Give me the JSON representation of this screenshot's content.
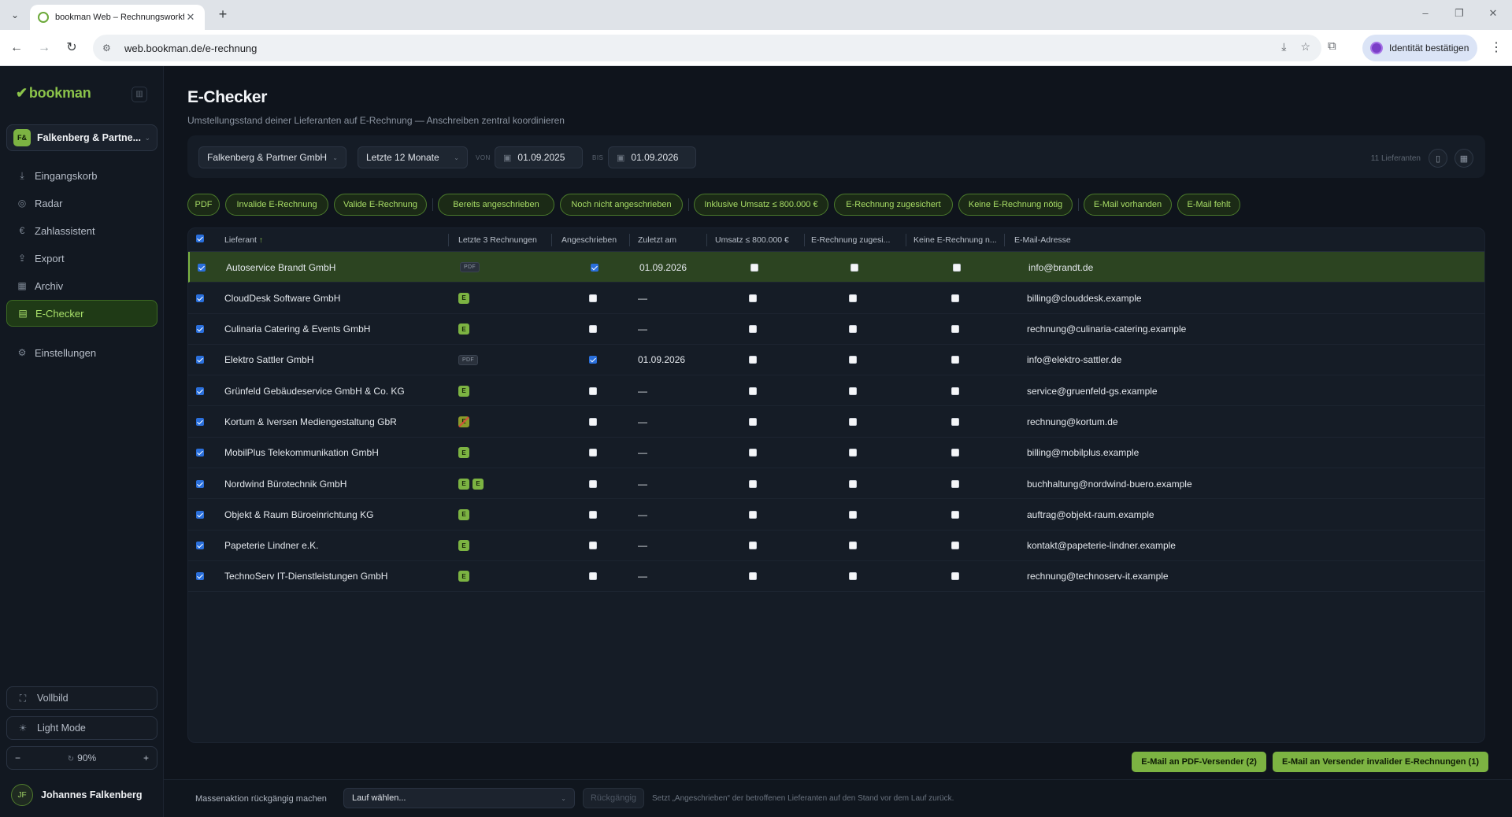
{
  "browser": {
    "tab_title": "bookman Web – Rechnungsworkfl",
    "url": "web.bookman.de/e-rechnung",
    "identity_label": "Identität bestätigen"
  },
  "sidebar": {
    "logo": "bookman",
    "company_badge": "F&",
    "company_name": "Falkenberg & Partne...",
    "nav": [
      {
        "label": "Eingangskorb",
        "icon": "inbox-icon"
      },
      {
        "label": "Radar",
        "icon": "radar-icon"
      },
      {
        "label": "Zahlassistent",
        "icon": "euro-icon"
      },
      {
        "label": "Export",
        "icon": "export-icon"
      },
      {
        "label": "Archiv",
        "icon": "archive-icon"
      },
      {
        "label": "E-Checker",
        "icon": "document-check-icon",
        "active": true
      },
      {
        "label": "Einstellungen",
        "icon": "gear-icon"
      }
    ],
    "vollbild": "Vollbild",
    "light_mode": "Light Mode",
    "zoom": "90%",
    "user_initials": "JF",
    "user_name": "Johannes Falkenberg"
  },
  "page": {
    "title": "E-Checker",
    "subtitle": "Umstellungsstand deiner Lieferanten auf E-Rechnung — Anschreiben zentral koordinieren"
  },
  "filters": {
    "company": "Falkenberg & Partner GmbH",
    "period": "Letzte 12 Monate",
    "von_label": "VON",
    "von": "01.09.2025",
    "bis_label": "BIS",
    "bis": "01.09.2026",
    "count": "11 Lieferanten"
  },
  "chips": [
    "PDF",
    "Invalide E-Rechnung",
    "Valide E-Rechnung",
    "Bereits angeschrieben",
    "Noch nicht angeschrieben",
    "Inklusive Umsatz ≤ 800.000 €",
    "E-Rechnung zugesichert",
    "Keine E-Rechnung nötig",
    "E-Mail vorhanden",
    "E-Mail fehlt"
  ],
  "table": {
    "columns": [
      "Lieferant",
      "Letzte 3 Rechnungen",
      "Angeschrieben",
      "Zuletzt am",
      "Umsatz ≤ 800.000 €",
      "E-Rechnung zugesi...",
      "Keine E-Rechnung n...",
      "E-Mail-Adresse"
    ],
    "rows": [
      {
        "name": "Autoservice Brandt GmbH",
        "invoices": [
          "PDF"
        ],
        "angeschrieben": true,
        "zuletzt": "01.09.2026",
        "email": "info@brandt.de",
        "highlight": true
      },
      {
        "name": "CloudDesk Software GmbH",
        "invoices": [
          "E"
        ],
        "angeschrieben": false,
        "zuletzt": "—",
        "email": "billing@clouddesk.example"
      },
      {
        "name": "Culinaria Catering & Events GmbH",
        "invoices": [
          "E"
        ],
        "angeschrieben": false,
        "zuletzt": "—",
        "email": "rechnung@culinaria-catering.example"
      },
      {
        "name": "Elektro Sattler GmbH",
        "invoices": [
          "PDF"
        ],
        "angeschrieben": true,
        "zuletzt": "01.09.2026",
        "email": "info@elektro-sattler.de"
      },
      {
        "name": "Grünfeld Gebäudeservice GmbH & Co. KG",
        "invoices": [
          "E"
        ],
        "angeschrieben": false,
        "zuletzt": "—",
        "email": "service@gruenfeld-gs.example"
      },
      {
        "name": "Kortum & Iversen Mediengestaltung GbR",
        "invoices": [
          "E-invalid"
        ],
        "angeschrieben": false,
        "zuletzt": "—",
        "email": "rechnung@kortum.de"
      },
      {
        "name": "MobilPlus Telekommunikation GmbH",
        "invoices": [
          "E"
        ],
        "angeschrieben": false,
        "zuletzt": "—",
        "email": "billing@mobilplus.example"
      },
      {
        "name": "Nordwind Bürotechnik GmbH",
        "invoices": [
          "E",
          "E"
        ],
        "angeschrieben": false,
        "zuletzt": "—",
        "email": "buchhaltung@nordwind-buero.example"
      },
      {
        "name": "Objekt & Raum Büroeinrichtung KG",
        "invoices": [
          "E"
        ],
        "angeschrieben": false,
        "zuletzt": "—",
        "email": "auftrag@objekt-raum.example"
      },
      {
        "name": "Papeterie Lindner e.K.",
        "invoices": [
          "E"
        ],
        "angeschrieben": false,
        "zuletzt": "—",
        "email": "kontakt@papeterie-lindner.example"
      },
      {
        "name": "TechnoServ IT-Dienstleistungen GmbH",
        "invoices": [
          "E"
        ],
        "angeschrieben": false,
        "zuletzt": "—",
        "email": "rechnung@technoserv-it.example"
      }
    ]
  },
  "actions": {
    "pdf_mail": "E-Mail an PDF-Versender (2)",
    "invalid_mail": "E-Mail an Versender invalider E-Rechnungen (1)"
  },
  "bottom": {
    "label": "Massenaktion rückgängig machen",
    "select": "Lauf wählen...",
    "undo": "Rückgängig",
    "hint": "Setzt „Angeschrieben“ der betroffenen Lieferanten auf den Stand vor dem Lauf zurück."
  }
}
